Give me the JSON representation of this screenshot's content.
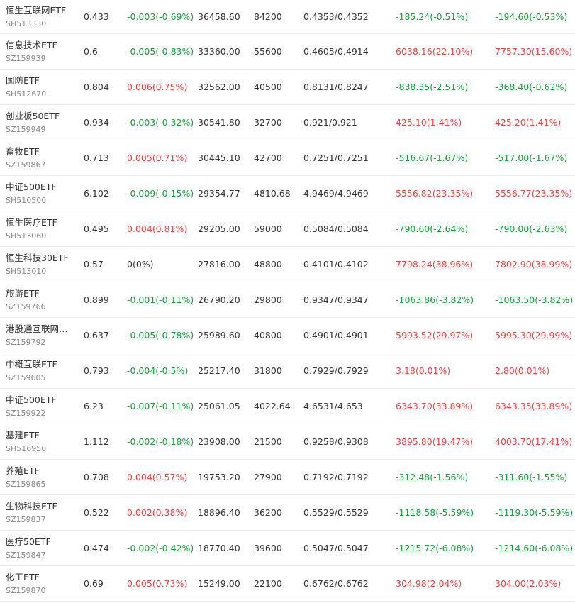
{
  "colors": {
    "up": "#e64545",
    "down": "#1a9e3c",
    "flat": "#333333"
  },
  "rows": [
    {
      "name": "恒生互联网ETF",
      "code": "SH513330",
      "price": "0.433",
      "change": "-0.003(-0.69%)",
      "change_dir": "down",
      "volume": "36458.60",
      "holding": "84200",
      "cost": "0.4353/0.4352",
      "profit": "-185.24(-0.51%)",
      "profit_dir": "down",
      "profit2": "-194.60(-0.53%)",
      "profit2_dir": "down"
    },
    {
      "name": "信息技术ETF",
      "code": "SZ159939",
      "price": "0.6",
      "change": "-0.005(-0.83%)",
      "change_dir": "down",
      "volume": "33360.00",
      "holding": "55600",
      "cost": "0.4605/0.4914",
      "profit": "6038.16(22.10%)",
      "profit_dir": "up",
      "profit2": "7757.30(15.60%)",
      "profit2_dir": "up"
    },
    {
      "name": "国防ETF",
      "code": "SH512670",
      "price": "0.804",
      "change": "0.006(0.75%)",
      "change_dir": "up",
      "volume": "32562.00",
      "holding": "40500",
      "cost": "0.8131/0.8247",
      "profit": "-838.35(-2.51%)",
      "profit_dir": "down",
      "profit2": "-368.40(-0.62%)",
      "profit2_dir": "down"
    },
    {
      "name": "创业板50ETF",
      "code": "SZ159949",
      "price": "0.934",
      "change": "-0.003(-0.32%)",
      "change_dir": "down",
      "volume": "30541.80",
      "holding": "32700",
      "cost": "0.921/0.921",
      "profit": "425.10(1.41%)",
      "profit_dir": "up",
      "profit2": "425.20(1.41%)",
      "profit2_dir": "up"
    },
    {
      "name": "畜牧ETF",
      "code": "SZ159867",
      "price": "0.713",
      "change": "0.005(0.71%)",
      "change_dir": "up",
      "volume": "30445.10",
      "holding": "42700",
      "cost": "0.7251/0.7251",
      "profit": "-516.67(-1.67%)",
      "profit_dir": "down",
      "profit2": "-517.00(-1.67%)",
      "profit2_dir": "down"
    },
    {
      "name": "中证500ETF",
      "code": "SH510500",
      "price": "6.102",
      "change": "-0.009(-0.15%)",
      "change_dir": "down",
      "volume": "29354.77",
      "holding": "4810.68",
      "cost": "4.9469/4.9469",
      "profit": "5556.82(23.35%)",
      "profit_dir": "up",
      "profit2": "5556.77(23.35%)",
      "profit2_dir": "up"
    },
    {
      "name": "恒生医疗ETF",
      "code": "SH513060",
      "price": "0.495",
      "change": "0.004(0.81%)",
      "change_dir": "up",
      "volume": "29205.00",
      "holding": "59000",
      "cost": "0.5084/0.5084",
      "profit": "-790.60(-2.64%)",
      "profit_dir": "down",
      "profit2": "-790.00(-2.63%)",
      "profit2_dir": "down"
    },
    {
      "name": "恒生科技30ETF",
      "code": "SH513010",
      "price": "0.57",
      "change": "0(0%)",
      "change_dir": "flat",
      "volume": "27816.00",
      "holding": "48800",
      "cost": "0.4101/0.4102",
      "profit": "7798.24(38.96%)",
      "profit_dir": "up",
      "profit2": "7802.90(38.99%)",
      "profit2_dir": "up"
    },
    {
      "name": "旅游ETF",
      "code": "SZ159766",
      "price": "0.899",
      "change": "-0.001(-0.11%)",
      "change_dir": "down",
      "volume": "26790.20",
      "holding": "29800",
      "cost": "0.9347/0.9347",
      "profit": "-1063.86(-3.82%)",
      "profit_dir": "down",
      "profit2": "-1063.50(-3.82%)",
      "profit2_dir": "down"
    },
    {
      "name": "港股通互联网…",
      "code": "SZ159792",
      "price": "0.637",
      "change": "-0.005(-0.78%)",
      "change_dir": "down",
      "volume": "25989.60",
      "holding": "40800",
      "cost": "0.4901/0.4901",
      "profit": "5993.52(29.97%)",
      "profit_dir": "up",
      "profit2": "5995.30(29.99%)",
      "profit2_dir": "up"
    },
    {
      "name": "中概互联ETF",
      "code": "SZ159605",
      "price": "0.793",
      "change": "-0.004(-0.5%)",
      "change_dir": "down",
      "volume": "25217.40",
      "holding": "31800",
      "cost": "0.7929/0.7929",
      "profit": "3.18(0.01%)",
      "profit_dir": "up",
      "profit2": "2.80(0.01%)",
      "profit2_dir": "up"
    },
    {
      "name": "中证500ETF",
      "code": "SZ159922",
      "price": "6.23",
      "change": "-0.007(-0.11%)",
      "change_dir": "down",
      "volume": "25061.05",
      "holding": "4022.64",
      "cost": "4.6531/4.653",
      "profit": "6343.70(33.89%)",
      "profit_dir": "up",
      "profit2": "6343.35(33.89%)",
      "profit2_dir": "up"
    },
    {
      "name": "基建ETF",
      "code": "SH516950",
      "price": "1.112",
      "change": "-0.002(-0.18%)",
      "change_dir": "down",
      "volume": "23908.00",
      "holding": "21500",
      "cost": "0.9258/0.9308",
      "profit": "3895.80(19.47%)",
      "profit_dir": "up",
      "profit2": "4003.70(17.41%)",
      "profit2_dir": "up"
    },
    {
      "name": "养殖ETF",
      "code": "SZ159865",
      "price": "0.708",
      "change": "0.004(0.57%)",
      "change_dir": "up",
      "volume": "19753.20",
      "holding": "27900",
      "cost": "0.7192/0.7192",
      "profit": "-312.48(-1.56%)",
      "profit_dir": "down",
      "profit2": "-311.60(-1.55%)",
      "profit2_dir": "down"
    },
    {
      "name": "生物科技ETF",
      "code": "SZ159837",
      "price": "0.522",
      "change": "0.002(0.38%)",
      "change_dir": "up",
      "volume": "18896.40",
      "holding": "36200",
      "cost": "0.5529/0.5529",
      "profit": "-1118.58(-5.59%)",
      "profit_dir": "down",
      "profit2": "-1119.30(-5.59%)",
      "profit2_dir": "down"
    },
    {
      "name": "医疗50ETF",
      "code": "SZ159847",
      "price": "0.474",
      "change": "-0.002(-0.42%)",
      "change_dir": "down",
      "volume": "18770.40",
      "holding": "39600",
      "cost": "0.5047/0.5047",
      "profit": "-1215.72(-6.08%)",
      "profit_dir": "down",
      "profit2": "-1214.60(-6.08%)",
      "profit2_dir": "down"
    },
    {
      "name": "化工ETF",
      "code": "SZ159870",
      "price": "0.69",
      "change": "0.005(0.73%)",
      "change_dir": "up",
      "volume": "15249.00",
      "holding": "22100",
      "cost": "0.6762/0.6762",
      "profit": "304.98(2.04%)",
      "profit_dir": "up",
      "profit2": "304.00(2.03%)",
      "profit2_dir": "up"
    }
  ]
}
